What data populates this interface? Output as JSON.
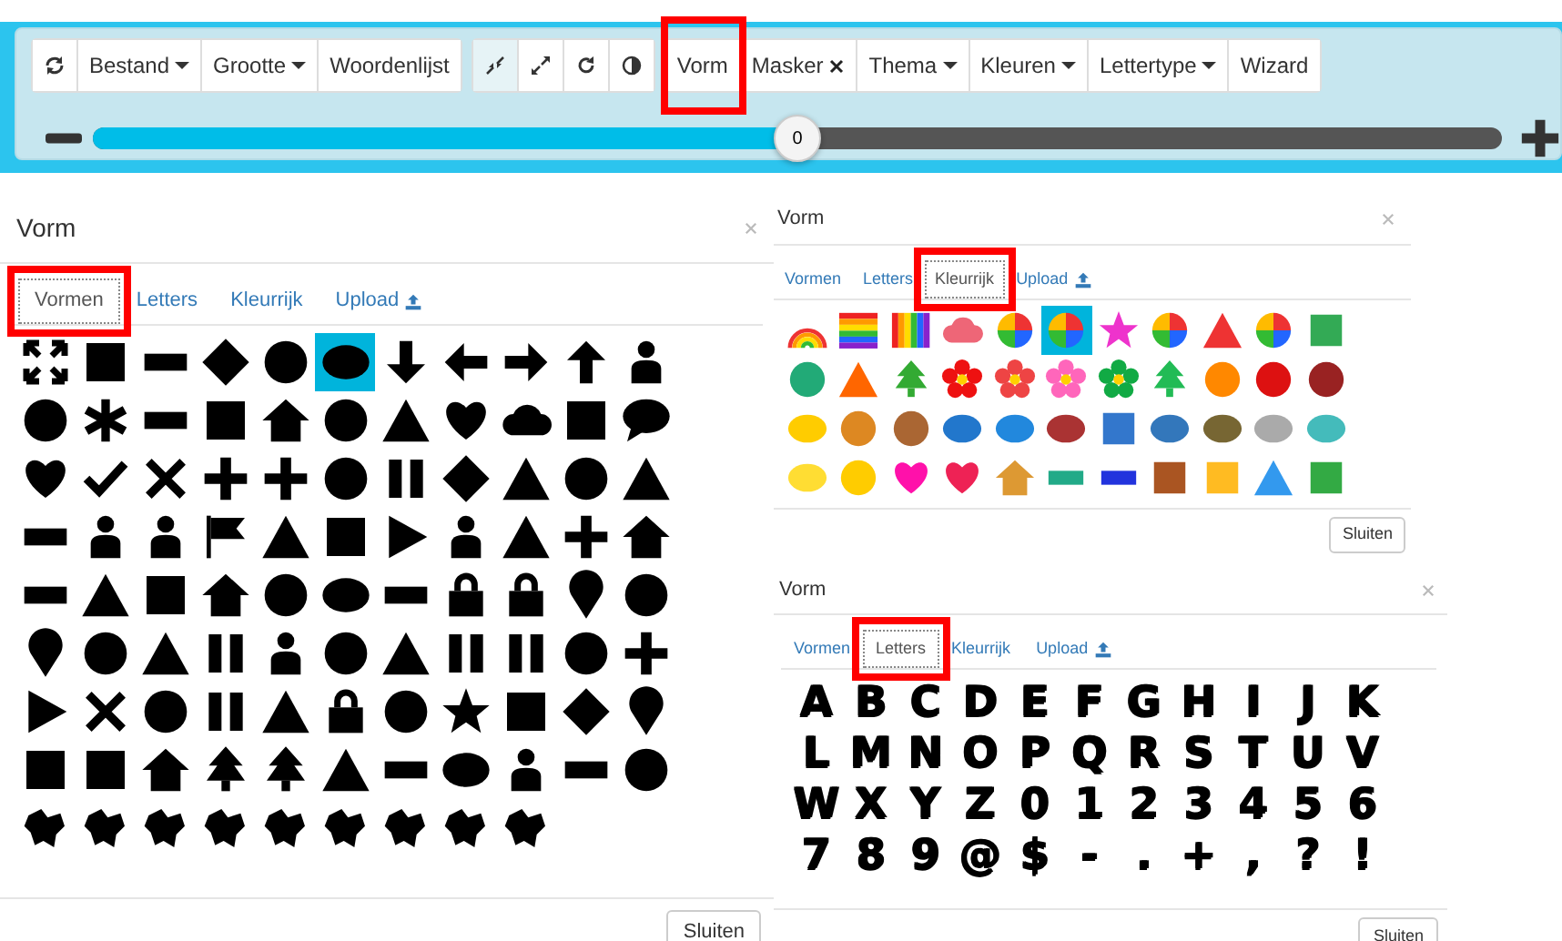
{
  "toolbar": {
    "groups": [
      {
        "buttons": [
          {
            "kind": "icon",
            "active": false,
            "highlighted": false
          },
          {
            "kind": "dropdown",
            "label": "Bestand",
            "active": false,
            "highlighted": false
          },
          {
            "kind": "dropdown",
            "label": "Grootte",
            "active": false,
            "highlighted": false
          },
          {
            "kind": "plain",
            "label": "Woordenlijst",
            "active": false,
            "highlighted": false
          }
        ]
      },
      {
        "buttons": [
          {
            "kind": "icon",
            "active": true,
            "highlighted": false
          },
          {
            "kind": "icon",
            "active": false,
            "highlighted": false
          },
          {
            "kind": "icon",
            "active": false,
            "highlighted": false
          },
          {
            "kind": "icon",
            "active": false,
            "highlighted": false
          }
        ]
      },
      {
        "buttons": [
          {
            "kind": "plain",
            "label": "Vorm",
            "active": false,
            "highlighted": true
          },
          {
            "kind": "removable",
            "label": "Masker",
            "active": false,
            "highlighted": false
          },
          {
            "kind": "dropdown",
            "label": "Thema",
            "active": false,
            "highlighted": false
          },
          {
            "kind": "dropdown",
            "label": "Kleuren",
            "active": false,
            "highlighted": false
          },
          {
            "kind": "dropdown",
            "label": "Lettertype",
            "active": false,
            "highlighted": false
          },
          {
            "kind": "plain",
            "label": "Wizard",
            "active": false,
            "highlighted": false
          }
        ]
      }
    ],
    "slider": {
      "level": 0.5,
      "reading": "0"
    }
  },
  "dialogs": [
    {
      "title": "Vorm",
      "tabs": [
        {
          "label": "Vormen",
          "selected": true,
          "highlighted": true,
          "kind": "text"
        },
        {
          "label": "Letters",
          "selected": false,
          "highlighted": false,
          "kind": "text"
        },
        {
          "label": "Kleurrijk",
          "selected": false,
          "highlighted": false,
          "kind": "text"
        },
        {
          "label": "Upload",
          "selected": false,
          "highlighted": false,
          "kind": "upload"
        }
      ],
      "grid": {
        "kind": "shapes",
        "items": [
          {
            "selected": false
          },
          {
            "selected": false
          },
          {
            "selected": false
          },
          {
            "selected": false
          },
          {
            "selected": false
          },
          {
            "selected": true
          },
          {
            "selected": false
          },
          {
            "selected": false
          },
          {
            "selected": false
          },
          {
            "selected": false
          },
          {
            "selected": false
          },
          {
            "selected": false
          },
          {
            "selected": false
          },
          {
            "selected": false
          },
          {
            "selected": false
          },
          {
            "selected": false
          },
          {
            "selected": false
          },
          {
            "selected": false
          },
          {
            "selected": false
          },
          {
            "selected": false
          },
          {
            "selected": false
          },
          {
            "selected": false
          },
          {
            "selected": false
          },
          {
            "selected": false
          },
          {
            "selected": false
          },
          {
            "selected": false
          },
          {
            "selected": false
          },
          {
            "selected": false
          },
          {
            "selected": false
          },
          {
            "selected": false
          },
          {
            "selected": false
          },
          {
            "selected": false
          },
          {
            "selected": false
          },
          {
            "selected": false
          },
          {
            "selected": false
          },
          {
            "selected": false
          },
          {
            "selected": false
          },
          {
            "selected": false
          },
          {
            "selected": false
          },
          {
            "selected": false
          },
          {
            "selected": false
          },
          {
            "selected": false
          },
          {
            "selected": false
          },
          {
            "selected": false
          },
          {
            "selected": false
          },
          {
            "selected": false
          },
          {
            "selected": false
          },
          {
            "selected": false
          },
          {
            "selected": false
          },
          {
            "selected": false
          },
          {
            "selected": false
          },
          {
            "selected": false
          },
          {
            "selected": false
          },
          {
            "selected": false
          },
          {
            "selected": false
          },
          {
            "selected": false
          },
          {
            "selected": false
          },
          {
            "selected": false
          },
          {
            "selected": false
          },
          {
            "selected": false
          },
          {
            "selected": false
          },
          {
            "selected": false
          },
          {
            "selected": false
          },
          {
            "selected": false
          },
          {
            "selected": false
          },
          {
            "selected": false
          },
          {
            "selected": false
          },
          {
            "selected": false
          },
          {
            "selected": false
          },
          {
            "selected": false
          },
          {
            "selected": false
          },
          {
            "selected": false
          },
          {
            "selected": false
          },
          {
            "selected": false
          },
          {
            "selected": false
          },
          {
            "selected": false
          },
          {
            "selected": false
          },
          {
            "selected": false
          },
          {
            "selected": false
          },
          {
            "selected": false
          },
          {
            "selected": false
          },
          {
            "selected": false
          },
          {
            "selected": false
          },
          {
            "selected": false
          },
          {
            "selected": false
          },
          {
            "selected": false
          },
          {
            "selected": false
          },
          {
            "selected": false
          },
          {
            "selected": false
          },
          {
            "selected": false
          },
          {
            "selected": false
          },
          {
            "selected": false
          },
          {
            "selected": false
          },
          {
            "selected": false
          },
          {
            "selected": false
          },
          {
            "selected": false
          },
          {
            "selected": false
          }
        ]
      },
      "close_button": "Sluiten"
    },
    {
      "title": "Vorm",
      "tabs": [
        {
          "label": "Vormen",
          "selected": false,
          "highlighted": false,
          "kind": "text"
        },
        {
          "label": "Letters",
          "selected": false,
          "highlighted": false,
          "kind": "text"
        },
        {
          "label": "Kleurrijk",
          "selected": true,
          "highlighted": true,
          "kind": "text"
        },
        {
          "label": "Upload",
          "selected": false,
          "highlighted": false,
          "kind": "upload"
        }
      ],
      "grid": {
        "kind": "colorful",
        "items": [
          {
            "selected": false
          },
          {
            "selected": false
          },
          {
            "selected": false
          },
          {
            "selected": false
          },
          {
            "selected": false
          },
          {
            "selected": true
          },
          {
            "selected": false
          },
          {
            "selected": false
          },
          {
            "selected": false
          },
          {
            "selected": false
          },
          {
            "selected": false
          },
          {
            "selected": false
          },
          {
            "selected": false
          },
          {
            "selected": false
          },
          {
            "selected": false
          },
          {
            "selected": false
          },
          {
            "selected": false
          },
          {
            "selected": false
          },
          {
            "selected": false
          },
          {
            "selected": false
          },
          {
            "selected": false
          },
          {
            "selected": false
          },
          {
            "selected": false
          },
          {
            "selected": false
          },
          {
            "selected": false
          },
          {
            "selected": false
          },
          {
            "selected": false
          },
          {
            "selected": false
          },
          {
            "selected": false
          },
          {
            "selected": false
          },
          {
            "selected": false
          },
          {
            "selected": false
          },
          {
            "selected": false
          },
          {
            "selected": false
          },
          {
            "selected": false
          },
          {
            "selected": false
          },
          {
            "selected": false
          },
          {
            "selected": false
          },
          {
            "selected": false
          },
          {
            "selected": false
          },
          {
            "selected": false
          },
          {
            "selected": false
          },
          {
            "selected": false
          },
          {
            "selected": false
          }
        ]
      },
      "close_button": "Sluiten"
    },
    {
      "title": "Vorm",
      "tabs": [
        {
          "label": "Vormen",
          "selected": false,
          "highlighted": false,
          "kind": "text"
        },
        {
          "label": "Letters",
          "selected": true,
          "highlighted": true,
          "kind": "text"
        },
        {
          "label": "Kleurrijk",
          "selected": false,
          "highlighted": false,
          "kind": "text"
        },
        {
          "label": "Upload",
          "selected": false,
          "highlighted": false,
          "kind": "upload"
        }
      ],
      "grid": {
        "kind": "letters",
        "items": [
          "A",
          "B",
          "C",
          "D",
          "E",
          "F",
          "G",
          "H",
          "I",
          "J",
          "K",
          "L",
          "M",
          "N",
          "O",
          "P",
          "Q",
          "R",
          "S",
          "T",
          "U",
          "V",
          "W",
          "X",
          "Y",
          "Z",
          "0",
          "1",
          "2",
          "3",
          "4",
          "5",
          "6",
          "7",
          "8",
          "9",
          "@",
          "$",
          "-",
          ".",
          "+",
          ",",
          "?",
          "!"
        ]
      },
      "close_button": "Sluiten"
    }
  ]
}
